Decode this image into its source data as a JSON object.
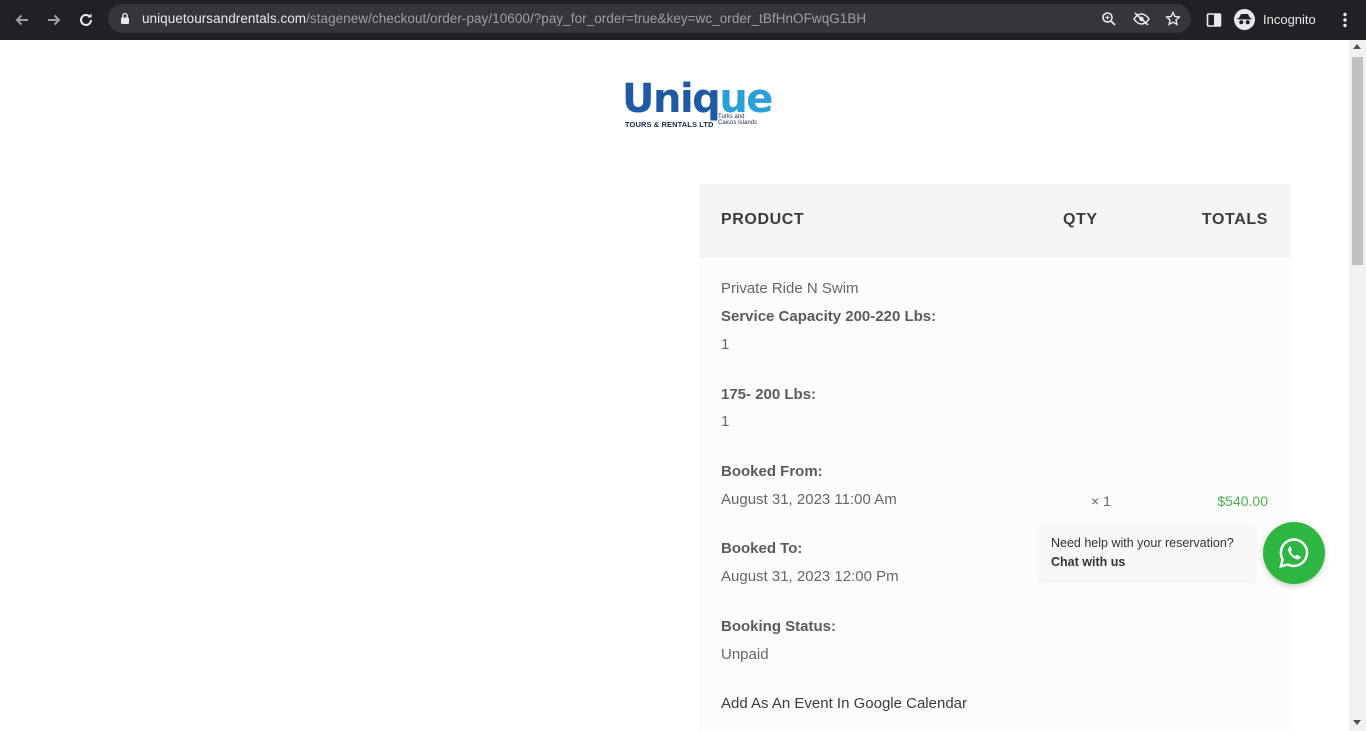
{
  "browser": {
    "url_host": "uniquetoursandrentals.com",
    "url_path": "/stagenew/checkout/order-pay/10600/?pay_for_order=true&key=wc_order_tBfHnOFwqG1BH",
    "profile_label": "Incognito",
    "icons": [
      "back-icon",
      "forward-icon",
      "reload-icon",
      "lock-icon",
      "zoom-icon",
      "eye-off-icon",
      "star-icon",
      "sidepanel-icon",
      "incognito-icon",
      "kebab-menu-icon"
    ]
  },
  "logo": {
    "word": "Uniq",
    "word_accent": "ue",
    "tagline": "TOURS & RENTALS LTD",
    "small_line1": "Turks and",
    "small_line2": "Caicos Islands"
  },
  "order": {
    "headers": {
      "product": "PRODUCT",
      "qty": "QTY",
      "totals": "TOTALS"
    },
    "product_name": "Private Ride N Swim",
    "service_capacity_label": "Service Capacity 200-220 Lbs:",
    "service_capacity_value": "1",
    "weight_label": "175- 200 Lbs:",
    "weight_value": "1",
    "booked_from_label": "Booked From:",
    "booked_from_value": "August 31, 2023 11:00 Am",
    "booked_to_label": "Booked To:",
    "booked_to_value": "August 31, 2023 12:00 Pm",
    "booking_status_label": "Booking Status:",
    "booking_status_value": "Unpaid",
    "calendar_link": "Add As An Event In Google Calendar",
    "qty_value": "× 1",
    "total_value": "$540.00"
  },
  "chat": {
    "prompt": "Need help with your reservation?",
    "cta": "Chat with us"
  },
  "colors": {
    "chrome_bg": "#202124",
    "total_green": "#4caf50",
    "whatsapp_green": "#2db742",
    "logo_blue": "#1f5aa6"
  }
}
